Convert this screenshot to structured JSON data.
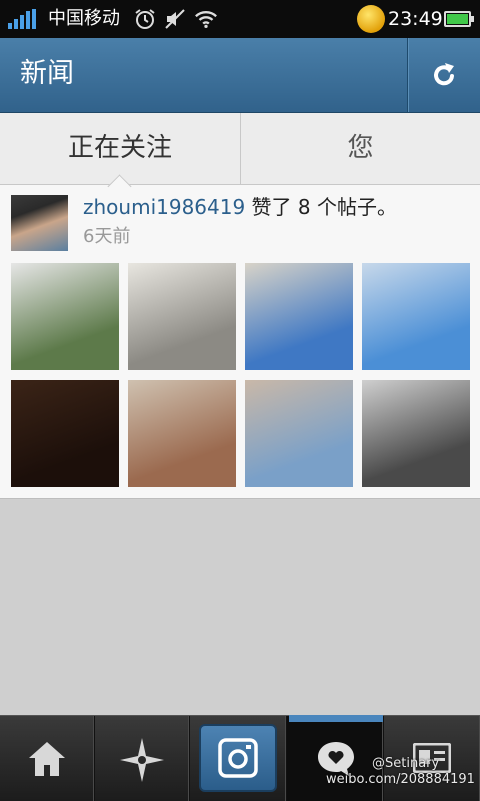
{
  "status_bar": {
    "carrier": "中国移动",
    "time": "23:49",
    "battery_level": 1.0,
    "icons": [
      "signal-icon",
      "alarm-icon",
      "mute-icon",
      "wifi-icon",
      "app-badge-icon",
      "battery-icon"
    ]
  },
  "header": {
    "title": "新闻",
    "refresh_icon": "refresh-icon"
  },
  "tabs": [
    {
      "label": "正在关注",
      "selected": true
    },
    {
      "label": "您",
      "selected": false
    }
  ],
  "feed": [
    {
      "username": "zhoumi1986419",
      "action_text": " 赞了 8 个帖子。",
      "time_ago": "6天前",
      "thumbnails": [
        {
          "name": "photo-statue-park",
          "colors": [
            "#5d7a4a",
            "#e6e6e6"
          ]
        },
        {
          "name": "photo-white-dog",
          "colors": [
            "#8c8a84",
            "#e8e6e0"
          ]
        },
        {
          "name": "photo-fountain-girl",
          "colors": [
            "#3f78c4",
            "#d8d3c8"
          ]
        },
        {
          "name": "photo-sea-girl",
          "colors": [
            "#4b8fd6",
            "#c7d8ea"
          ]
        },
        {
          "name": "photo-dark-shadow",
          "colors": [
            "#1c0f0a",
            "#3b2417"
          ]
        },
        {
          "name": "photo-brick-arches",
          "colors": [
            "#9b6a4f",
            "#cfc1b0"
          ]
        },
        {
          "name": "photo-two-girls-street",
          "colors": [
            "#7aa0c8",
            "#c9b8a8"
          ]
        },
        {
          "name": "photo-bw-cafe",
          "colors": [
            "#4a4a4a",
            "#cfcfcf"
          ]
        }
      ]
    }
  ],
  "bottom_nav": [
    {
      "name": "home",
      "icon": "home-icon",
      "active": false
    },
    {
      "name": "explore",
      "icon": "explore-star-icon",
      "active": false
    },
    {
      "name": "camera",
      "icon": "camera-icon",
      "active": false
    },
    {
      "name": "activity",
      "icon": "heart-bubble-icon",
      "active": true
    },
    {
      "name": "profile",
      "icon": "profile-card-icon",
      "active": false
    }
  ],
  "watermark": {
    "handle": "@Setinary",
    "url": "weibo.com/208884191"
  },
  "colors": {
    "header_blue": "#3a6d96",
    "username_blue": "#2b5f8c",
    "active_tab_bar": "#4a86bd"
  }
}
